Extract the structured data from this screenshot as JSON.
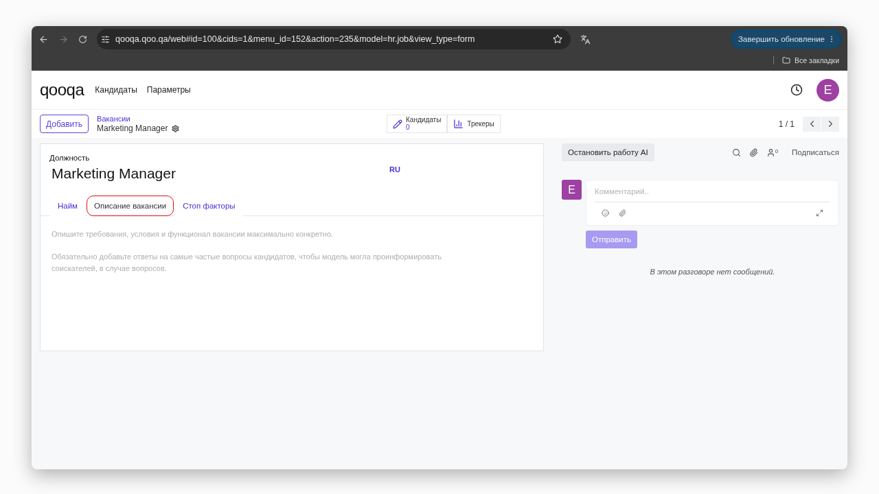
{
  "browser": {
    "url": "qooqa.qoo.qa/web#id=100&cids=1&menu_id=152&action=235&model=hr.job&view_type=form",
    "update_button": "Завершить обновление",
    "bookmarks": "Все закладки"
  },
  "navbar": {
    "logo": "qooqa",
    "menu": [
      "Кандидаты",
      "Параметры"
    ],
    "avatar": "E"
  },
  "control_panel": {
    "add_button": "Добавить",
    "breadcrumb": "Вакансии",
    "record": "Marketing Manager",
    "smart_buttons": [
      {
        "kind": "stat",
        "label": "Кандидаты",
        "value": "0"
      },
      {
        "kind": "plain",
        "label": "Трекеры"
      }
    ],
    "pager": "1 / 1"
  },
  "form": {
    "field_label": "Должность",
    "name": "Marketing Manager",
    "lang": "RU",
    "tabs": [
      {
        "label": "Найм",
        "selected": false,
        "highlighted": false
      },
      {
        "label": "Описание вакансии",
        "selected": true,
        "highlighted": true
      },
      {
        "label": "Стоп факторы",
        "selected": false,
        "highlighted": false
      }
    ],
    "placeholder_lines": [
      "Опишите требования, условия и функционал вакансии максимально конкретно.",
      "Обязательно добавьте ответы на самые частые вопросы кандидатов, чтобы модель могла проинформировать соискателей, в случае вопросов."
    ]
  },
  "chatter": {
    "stop_ai_button": "Остановить работу AI",
    "followers_count": "0",
    "subscribe": "Подписаться",
    "avatar": "E",
    "comment_placeholder": "Комментарий..",
    "send_button": "Отправить",
    "send_disabled": true,
    "empty_message": "В этом разговоре нет сообщений."
  }
}
